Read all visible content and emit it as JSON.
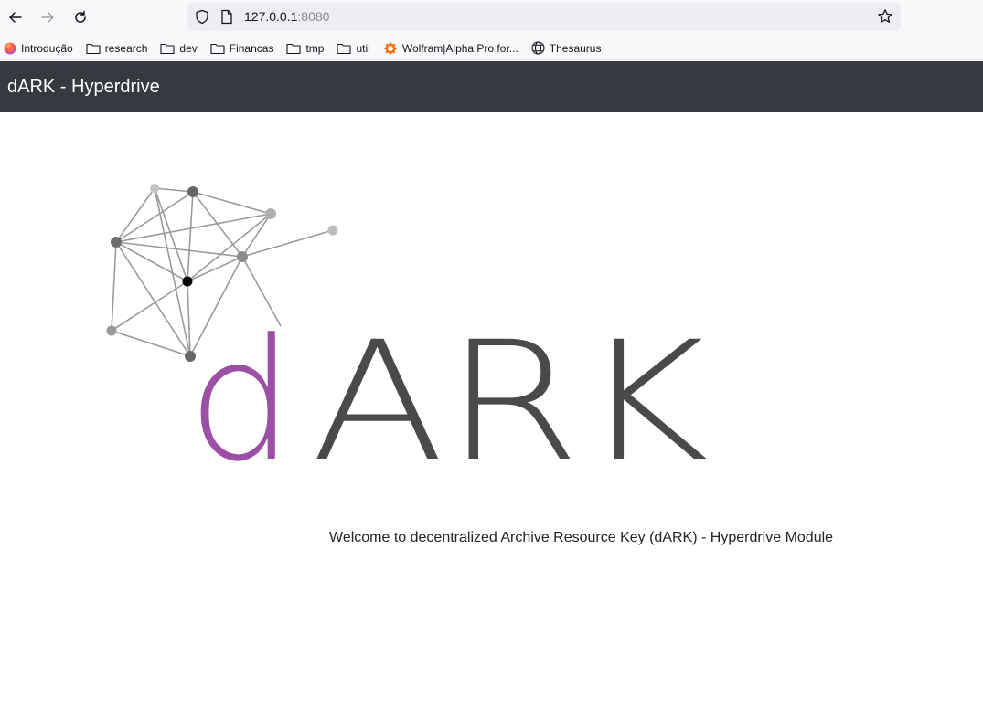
{
  "browser": {
    "url_host": "127.0.0.1",
    "url_port": ":8080",
    "bookmarks": [
      {
        "label": "Introdução",
        "icon": "firefox-icon"
      },
      {
        "label": "research",
        "icon": "folder-icon"
      },
      {
        "label": "dev",
        "icon": "folder-icon"
      },
      {
        "label": "Financas",
        "icon": "folder-icon"
      },
      {
        "label": "tmp",
        "icon": "folder-icon"
      },
      {
        "label": "util",
        "icon": "folder-icon"
      },
      {
        "label": "Wolfram|Alpha Pro for...",
        "icon": "wolfram-icon"
      },
      {
        "label": "Thesaurus",
        "icon": "globe-icon"
      }
    ]
  },
  "navbar": {
    "brand": "dARK - Hyperdrive",
    "background": "#343a40"
  },
  "logo": {
    "letter_d": "d",
    "letters_ark": "ARK",
    "d_color": "#9b4fa5",
    "ark_color": "#4a4a4a"
  },
  "main": {
    "welcome": "Welcome to decentralized Archive Resource Key (dARK) - Hyperdrive Module"
  }
}
